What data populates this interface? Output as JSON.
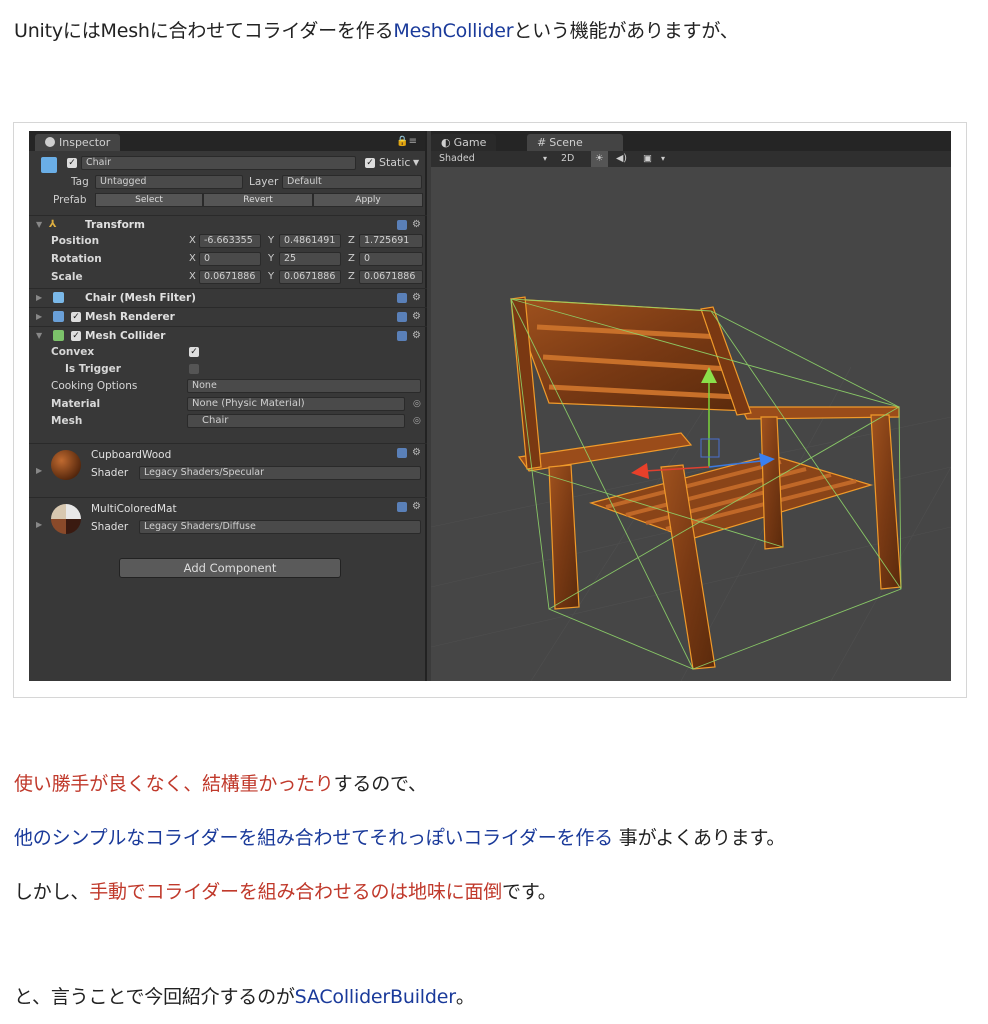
{
  "intro": {
    "part1": "UnityにはMeshに合わせてコライダーを作る",
    "link": "MeshCollider",
    "part2": "という機能がありますが、"
  },
  "inspector": {
    "tab_label": "Inspector",
    "object_name": "Chair",
    "static_label": "Static",
    "tag_label": "Tag",
    "tag_value": "Untagged",
    "layer_label": "Layer",
    "layer_value": "Default",
    "prefab_label": "Prefab",
    "prefab_buttons": [
      "Select",
      "Revert",
      "Apply"
    ],
    "transform": {
      "title": "Transform",
      "position_label": "Position",
      "rotation_label": "Rotation",
      "scale_label": "Scale",
      "position": [
        "-6.663355",
        "0.4861491",
        "1.725691"
      ],
      "rotation": [
        "0",
        "25",
        "0"
      ],
      "scale": [
        "0.0671886",
        "0.0671886",
        "0.0671886"
      ],
      "axes": [
        "X",
        "Y",
        "Z"
      ]
    },
    "mesh_filter_title": "Chair (Mesh Filter)",
    "mesh_renderer_title": "Mesh Renderer",
    "mesh_collider": {
      "title": "Mesh Collider",
      "convex_label": "Convex",
      "is_trigger_label": "Is Trigger",
      "cooking_label": "Cooking Options",
      "cooking_value": "None",
      "material_label": "Material",
      "material_value": "None (Physic Material)",
      "mesh_label": "Mesh",
      "mesh_value": "Chair"
    },
    "materials": [
      {
        "name": "CupboardWood",
        "shader_label": "Shader",
        "shader_value": "Legacy Shaders/Specular"
      },
      {
        "name": "MultiColoredMat",
        "shader_label": "Shader",
        "shader_value": "Legacy Shaders/Diffuse"
      }
    ],
    "add_component": "Add Component"
  },
  "scene": {
    "game_tab": "Game",
    "scene_tab": "Scene",
    "shading_mode": "Shaded",
    "mode_2d": "2D"
  },
  "body": {
    "line1_red": "使い勝手が良くなく、結構重かったり",
    "line1_rest": "するので、",
    "line2_blue": "他のシンプルなコライダーを組み合わせてそれっぽいコライダーを作る",
    "line2_rest": " 事がよくあります。",
    "line3_start": "しかし、",
    "line3_red": "手動でコライダーを組み合わせるのは地味に面倒",
    "line3_rest": "です。",
    "line4_start": "と、言うことで今回紹介するのが",
    "line4_link": "SAColliderBuilder",
    "line4_end": "。"
  },
  "colors": {
    "link": "#1a3a9a",
    "emphasis_red": "#c0392b",
    "editor_bg": "#383838",
    "scene_bg": "#464646"
  }
}
